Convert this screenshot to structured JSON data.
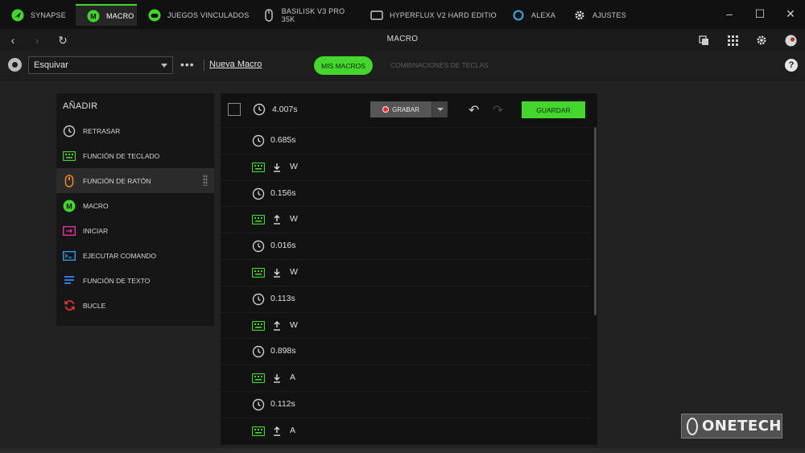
{
  "tabs": [
    {
      "label": "SYNAPSE",
      "icon": "razer-logo-icon"
    },
    {
      "label": "MACRO",
      "icon": "macro-m-icon",
      "active": true
    },
    {
      "label": "JUEGOS VINCULADOS",
      "icon": "gamepad-icon"
    },
    {
      "label": "BASILISK V3 PRO 35K",
      "icon": "mouse-icon"
    },
    {
      "label": "HYPERFLUX V2 HARD EDITIO",
      "icon": "mousepad-icon"
    },
    {
      "label": "ALEXA",
      "icon": "alexa-icon"
    },
    {
      "label": "AJUSTES",
      "icon": "gear-icon"
    }
  ],
  "nav": {
    "title": "MACRO"
  },
  "toolbar": {
    "selected_macro": "Esquivar",
    "new_macro_label": "Nueva Macro",
    "tab_my_macros": "MIS MACROS",
    "tab_key_combos": "COMBINACIONES DE TECLAS",
    "help_label": "?"
  },
  "add_panel": {
    "title": "AÑADIR",
    "items": [
      {
        "label": "RETRASAR",
        "icon": "clock-icon"
      },
      {
        "label": "FUNCIÓN DE TECLADO",
        "icon": "keyboard-icon"
      },
      {
        "label": "FUNCIÓN DE RATÓN",
        "icon": "mouse-function-icon"
      },
      {
        "label": "MACRO",
        "icon": "macro-m-icon"
      },
      {
        "label": "INICIAR",
        "icon": "launch-icon"
      },
      {
        "label": "EJECUTAR COMANDO",
        "icon": "command-icon"
      },
      {
        "label": "FUNCIÓN DE TEXTO",
        "icon": "text-icon"
      },
      {
        "label": "BUCLE",
        "icon": "loop-icon"
      }
    ]
  },
  "macro_panel": {
    "first_delay": "4.007s",
    "record_label": "GRABAR",
    "save_label": "GUARDAR",
    "steps": [
      {
        "type": "delay",
        "text": "0.685s"
      },
      {
        "type": "key",
        "dir": "down",
        "text": "W"
      },
      {
        "type": "delay",
        "text": "0.156s"
      },
      {
        "type": "key",
        "dir": "up",
        "text": "W"
      },
      {
        "type": "delay",
        "text": "0.016s"
      },
      {
        "type": "key",
        "dir": "down",
        "text": "W"
      },
      {
        "type": "delay",
        "text": "0.113s"
      },
      {
        "type": "key",
        "dir": "up",
        "text": "W"
      },
      {
        "type": "delay",
        "text": "0.898s"
      },
      {
        "type": "key",
        "dir": "down",
        "text": "A"
      },
      {
        "type": "delay",
        "text": "0.112s"
      },
      {
        "type": "key",
        "dir": "up",
        "text": "A"
      }
    ]
  },
  "watermark": {
    "text": "ONETECH"
  },
  "colors": {
    "accent": "#44d62c",
    "background": "#222222",
    "panel": "#161616",
    "record_dot": "#ff2b2b"
  }
}
